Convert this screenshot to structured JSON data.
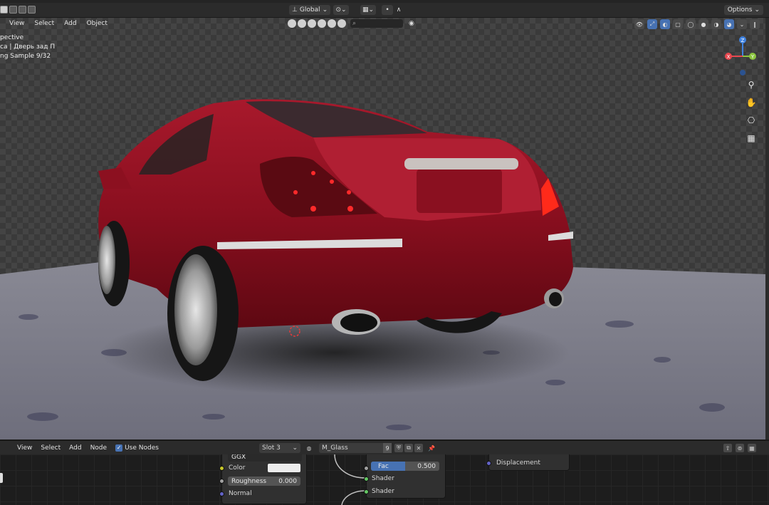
{
  "header": {
    "transform_orientation": "Global",
    "options_label": "Options"
  },
  "viewport": {
    "menu": [
      "View",
      "Select",
      "Add",
      "Object"
    ],
    "info_lines": [
      "pective",
      "ca | Дверь зад П",
      "ng Sample 9/32"
    ],
    "gizmo_axes": {
      "x": "X",
      "y": "Y",
      "z": "Z"
    },
    "colors": {
      "x_axis": "#e8484f",
      "y_axis": "#8bc53f",
      "z_axis": "#3f82e0"
    }
  },
  "node_editor": {
    "menu": [
      "View",
      "Select",
      "Add",
      "Node"
    ],
    "use_nodes_label": "Use Nodes",
    "slot": "Slot 3",
    "material": "M_Glass",
    "material_users": "9",
    "bsdf_node": {
      "distribution": "GGX",
      "color_label": "Color",
      "roughness_label": "Roughness",
      "roughness_value": "0.000",
      "normal_label": "Normal"
    },
    "mix_node": {
      "fac_label": "Fac",
      "fac_value": "0.500",
      "fac_fraction": 0.5,
      "shader1_label": "Shader",
      "shader2_label": "Shader"
    },
    "output_node": {
      "displacement_label": "Displacement"
    },
    "socket_colors": {
      "color": "#c7c729",
      "shader": "#63c763",
      "vector": "#6363c7",
      "float": "#a1a1a1"
    }
  }
}
